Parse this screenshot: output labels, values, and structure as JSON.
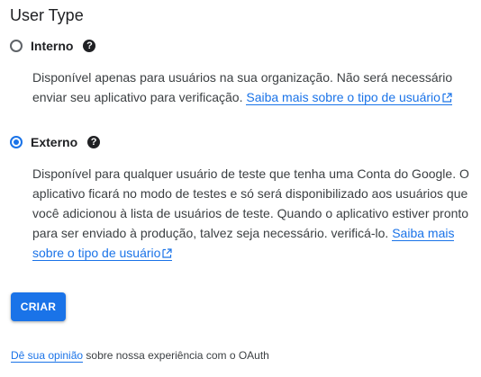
{
  "title": "User Type",
  "options": [
    {
      "label": "Interno",
      "checked": false,
      "help_icon": "?",
      "description": "Disponível apenas para usuários na sua organização. Não será necessário enviar seu aplicativo para verificação.",
      "link_text": "Saiba mais sobre o tipo de usuário",
      "link_icon": "external-link-icon"
    },
    {
      "label": "Externo",
      "checked": true,
      "help_icon": "?",
      "description": "Disponível para qualquer usuário de teste que tenha uma Conta do Google. O aplicativo ficará no modo de testes e só será disponibilizado aos usuários que você adicionou à lista de usuários de teste. Quando o aplicativo estiver pronto para ser enviado à produção, talvez seja necessário. verificá-lo.",
      "link_text": "Saiba mais sobre o tipo de usuário",
      "link_icon": "external-link-icon"
    }
  ],
  "create_button": "CRIAR",
  "feedback": {
    "link_text": "Dê sua opinião",
    "text": "sobre nossa experiência com o OAuth"
  },
  "colors": {
    "accent": "#1a73e8",
    "text": "#202124",
    "secondary_text": "#3c4043"
  }
}
